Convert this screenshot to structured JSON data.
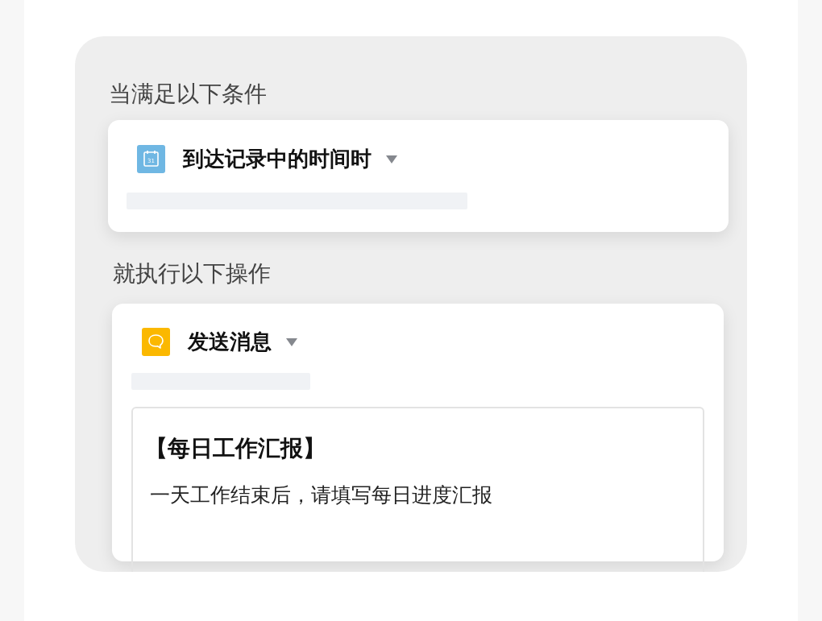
{
  "trigger": {
    "section_label": "当满足以下条件",
    "card": {
      "title": "到达记录中的时间时",
      "icon_day": "31"
    }
  },
  "action": {
    "section_label": "就执行以下操作",
    "card": {
      "title": "发送消息",
      "message": {
        "title": "【每日工作汇报】",
        "body": "一天工作结束后，请填写每日进度汇报"
      }
    }
  }
}
